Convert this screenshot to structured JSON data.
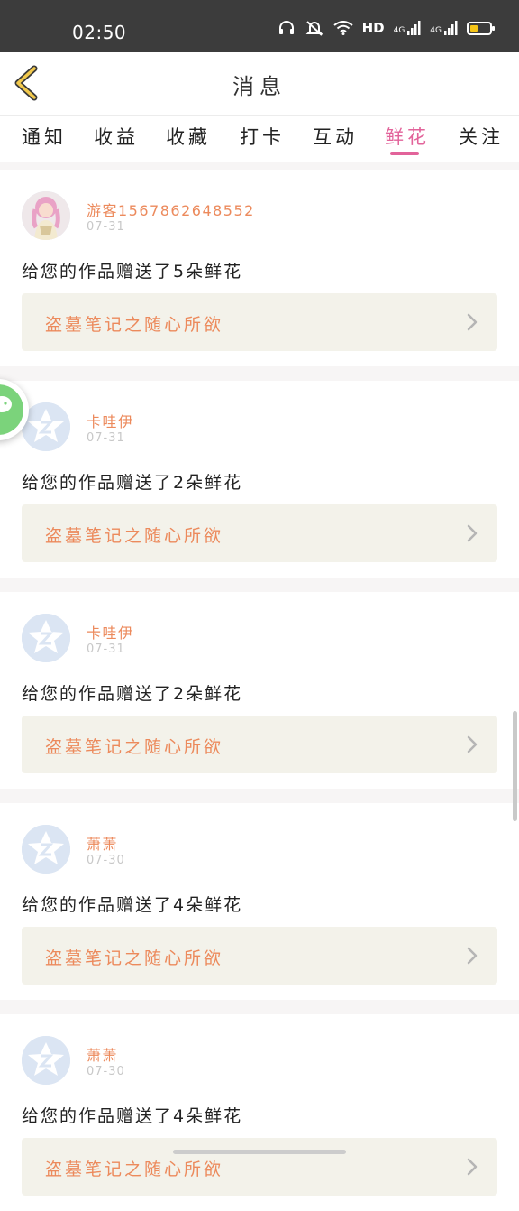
{
  "status_bar": {
    "time": "02:50",
    "hd": "HD",
    "net1": "4G",
    "net2": "4G"
  },
  "header": {
    "title": "消息"
  },
  "tabs": [
    {
      "label": "通知"
    },
    {
      "label": "收益"
    },
    {
      "label": "收藏"
    },
    {
      "label": "打卡"
    },
    {
      "label": "互动"
    },
    {
      "label": "鲜花",
      "active": true
    },
    {
      "label": "关注"
    }
  ],
  "messages": [
    {
      "user": "游客1567862648552",
      "date": "07-31",
      "text": "给您的作品赠送了5朵鲜花",
      "work": "盗墓笔记之随心所欲",
      "avatar": "custom-avatar"
    },
    {
      "user": "卡哇伊",
      "date": "07-31",
      "text": "给您的作品赠送了2朵鲜花",
      "work": "盗墓笔记之随心所欲",
      "avatar": "default-avatar"
    },
    {
      "user": "卡哇伊",
      "date": "07-31",
      "text": "给您的作品赠送了2朵鲜花",
      "work": "盗墓笔记之随心所欲",
      "avatar": "default-avatar"
    },
    {
      "user": "萧萧",
      "date": "07-30",
      "text": "给您的作品赠送了4朵鲜花",
      "work": "盗墓笔记之随心所欲",
      "avatar": "default-avatar"
    },
    {
      "user": "萧萧",
      "date": "07-30",
      "text": "给您的作品赠送了4朵鲜花",
      "work": "盗墓笔记之随心所欲",
      "avatar": "default-avatar"
    }
  ],
  "colors": {
    "accent": "#e2639a",
    "name": "#ec8a5c",
    "link_bg": "#f3f2ea",
    "float": "#7bd37b"
  },
  "icons": {
    "back": "chevron-left-icon",
    "float": "wechat-icon",
    "row": "chevron-right-icon"
  }
}
